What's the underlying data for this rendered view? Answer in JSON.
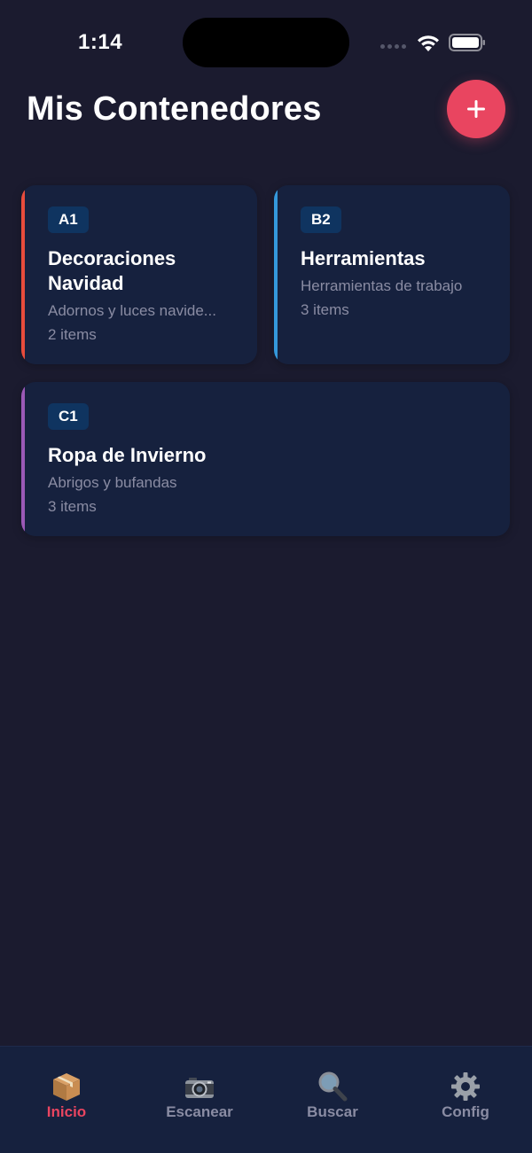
{
  "status_bar": {
    "time": "1:14"
  },
  "header": {
    "title": "Mis Contenedores",
    "add_button_icon": "plus-icon"
  },
  "colors": {
    "background": "#1b1b2f",
    "card": "#16213e",
    "badge": "#0f3460",
    "accent": "#e94560",
    "muted_text": "#8a8ca3"
  },
  "containers": [
    {
      "code": "A1",
      "title_line1": "Decoraciones",
      "title_line2": "Navidad",
      "description": "Adornos y luces navide...",
      "count": "2 items",
      "color": "#e74c3c"
    },
    {
      "code": "B2",
      "title_line1": "Herramientas",
      "description": "Herramientas de trabajo",
      "count": "3 items",
      "color": "#3498db"
    },
    {
      "code": "C1",
      "title_line1": "Ropa de Invierno",
      "description": "Abrigos y bufandas",
      "count": "3 items",
      "color": "#9b59b6"
    }
  ],
  "tabs": [
    {
      "label": "Inicio",
      "icon": "package-icon",
      "active": true
    },
    {
      "label": "Escanear",
      "icon": "camera-icon",
      "active": false
    },
    {
      "label": "Buscar",
      "icon": "magnifier-icon",
      "active": false
    },
    {
      "label": "Config",
      "icon": "gear-icon",
      "active": false
    }
  ]
}
